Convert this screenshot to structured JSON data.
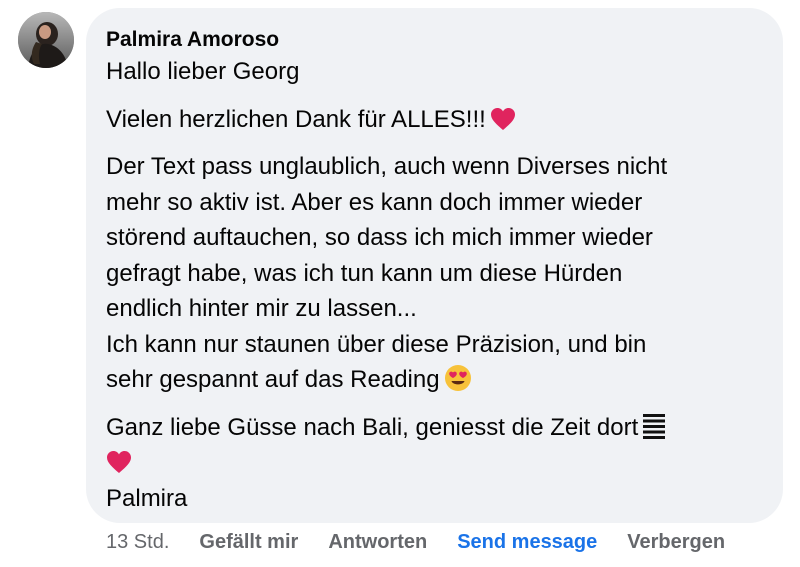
{
  "comment": {
    "author": "Palmira Amoroso",
    "lines": {
      "greeting": "Hallo lieber Georg",
      "thanks": "Vielen herzlichen Dank für ALLES!!!",
      "body_1": "Der Text pass unglaublich, auch wenn Diverses nicht",
      "body_2": "mehr so aktiv ist. Aber es kann doch immer wieder",
      "body_3": "störend auftauchen, so dass ich mich immer wieder",
      "body_4": "gefragt habe, was ich tun kann um diese Hürden",
      "body_5": "endlich hinter mir zu lassen...",
      "body_6": "Ich kann nur staunen über diese Präzision, und bin",
      "body_7": "sehr gespannt auf das Reading",
      "closing": "Ganz liebe Güsse nach Bali, geniesst die Zeit dort",
      "signature": "Palmira"
    },
    "icons": {
      "thanks_emoji": "red-heart-icon",
      "reading_emoji": "heart-eyes-icon",
      "closing_emoji": "bars-icon",
      "closing_heart": "red-heart-icon"
    }
  },
  "actions": {
    "timestamp": "13 Std.",
    "like": "Gefällt mir",
    "reply": "Antworten",
    "send_message": "Send message",
    "hide": "Verbergen"
  },
  "colors": {
    "bubble": "#f0f2f5",
    "text": "#050505",
    "secondary": "#65676b",
    "link_blue": "#1a73e8",
    "heart_red": "#e0245e"
  }
}
